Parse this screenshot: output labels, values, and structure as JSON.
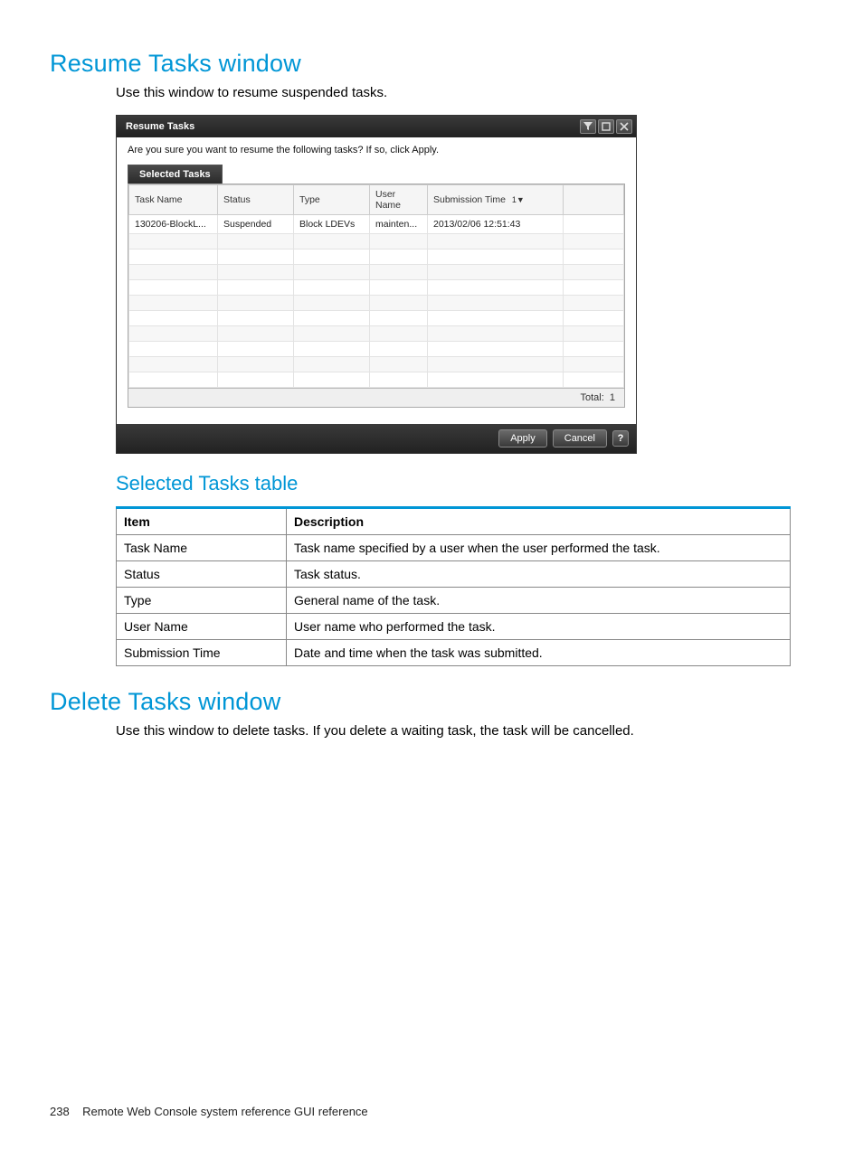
{
  "section1": {
    "heading": "Resume Tasks window",
    "intro": "Use this window to resume suspended tasks."
  },
  "win": {
    "title": "Resume Tasks",
    "prompt": "Are you sure you want to resume the following tasks? If so, click Apply.",
    "tab_label": "Selected Tasks",
    "cols": {
      "task_name": "Task Name",
      "status": "Status",
      "type": "Type",
      "user_name": "User\nName",
      "submission_time": "Submission Time",
      "sort": "1▼"
    },
    "rows": [
      {
        "task_name": "130206-BlockL...",
        "status": "Suspended",
        "type": "Block LDEVs",
        "user_name": "mainten...",
        "submission_time": "2013/02/06 12:51:43"
      }
    ],
    "total_label": "Total:",
    "total_value": "1",
    "apply": "Apply",
    "cancel": "Cancel",
    "help": "?"
  },
  "subheading": "Selected Tasks table",
  "doc_table": {
    "head_item": "Item",
    "head_desc": "Description",
    "rows": [
      {
        "item": "Task Name",
        "desc": "Task name specified by a user when the user performed the task."
      },
      {
        "item": "Status",
        "desc": "Task status."
      },
      {
        "item": "Type",
        "desc": "General name of the task."
      },
      {
        "item": "User Name",
        "desc": "User name who performed the task."
      },
      {
        "item": "Submission Time",
        "desc": "Date and time when the task was submitted."
      }
    ]
  },
  "section2": {
    "heading": "Delete Tasks window",
    "intro": "Use this window to delete tasks. If you delete a waiting task, the task will be cancelled."
  },
  "footer": {
    "page_num": "238",
    "text": "Remote Web Console system reference GUI reference"
  }
}
